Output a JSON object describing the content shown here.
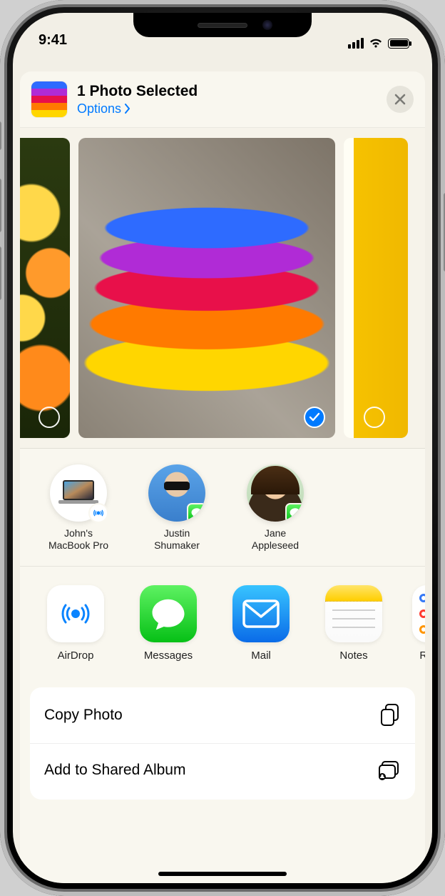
{
  "status": {
    "time": "9:41"
  },
  "header": {
    "title": "1 Photo Selected",
    "options_label": "Options"
  },
  "photos": {
    "selected_index": 1
  },
  "contacts": [
    {
      "name_line1": "John's",
      "name_line2": "MacBook Pro",
      "badge": "airdrop"
    },
    {
      "name_line1": "Justin",
      "name_line2": "Shumaker",
      "badge": "messages"
    },
    {
      "name_line1": "Jane",
      "name_line2": "Appleseed",
      "badge": "messages"
    }
  ],
  "apps": [
    {
      "label": "AirDrop"
    },
    {
      "label": "Messages"
    },
    {
      "label": "Mail"
    },
    {
      "label": "Notes"
    },
    {
      "label": "Re"
    }
  ],
  "actions": [
    {
      "label": "Copy Photo",
      "icon": "copy"
    },
    {
      "label": "Add to Shared Album",
      "icon": "shared-album"
    }
  ],
  "colors": {
    "tint": "#007aff"
  }
}
